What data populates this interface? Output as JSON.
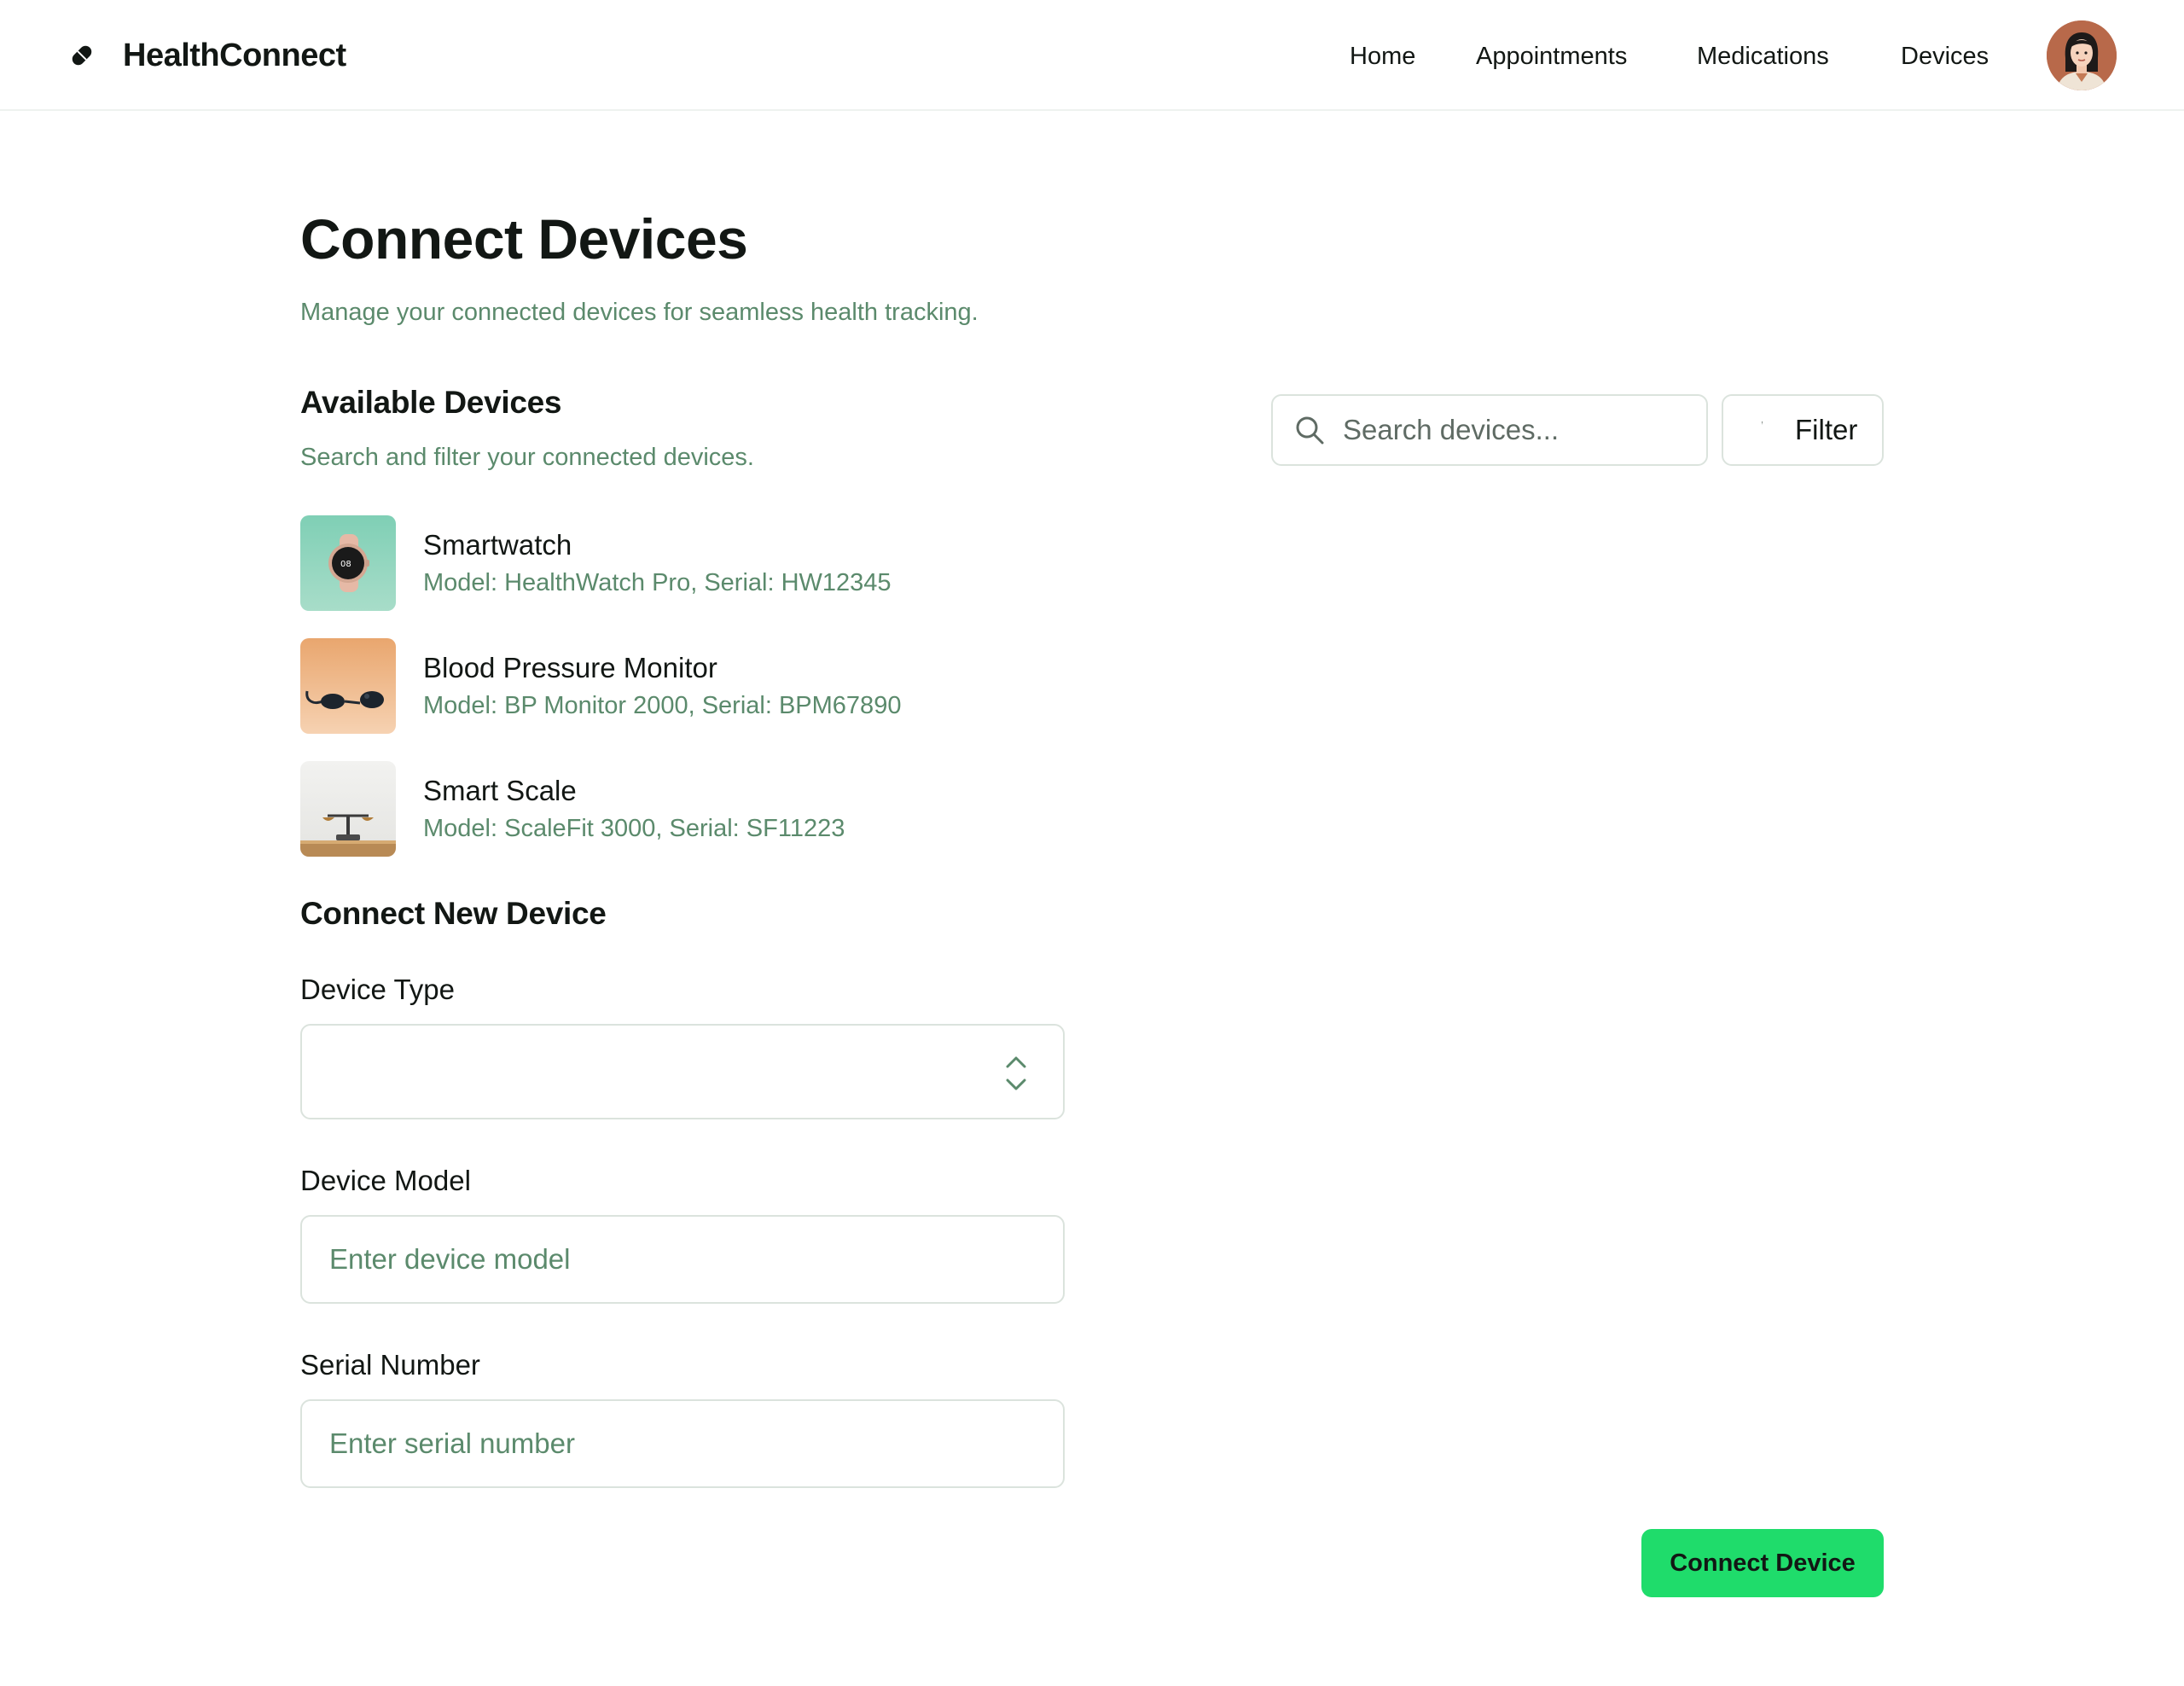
{
  "header": {
    "brand_name": "HealthConnect",
    "brand_icon": "pill-icon",
    "nav": [
      {
        "label": "Home"
      },
      {
        "label": "Appointments"
      },
      {
        "label": "Medications"
      },
      {
        "label": "Devices"
      }
    ],
    "avatar_icon": "user-avatar"
  },
  "main": {
    "title": "Connect Devices",
    "subtitle": "Manage your connected devices for seamless health tracking.",
    "available": {
      "title": "Available Devices",
      "subtitle": "Search and filter your connected devices.",
      "search_placeholder": "Search devices...",
      "search_icon": "search-icon",
      "filter_label": "Filter",
      "devices": [
        {
          "name": "Smartwatch",
          "meta": "Model: HealthWatch Pro, Serial: HW12345",
          "image": "smartwatch-image"
        },
        {
          "name": "Blood Pressure Monitor",
          "meta": "Model: BP Monitor 2000, Serial: BPM67890",
          "image": "blood-pressure-monitor-image"
        },
        {
          "name": "Smart Scale",
          "meta": "Model: ScaleFit 3000, Serial: SF11223",
          "image": "smart-scale-image"
        }
      ]
    },
    "connect_new": {
      "title": "Connect New Device",
      "device_type_label": "Device Type",
      "device_type_value": "",
      "device_model_label": "Device Model",
      "device_model_placeholder": "Enter device model",
      "serial_label": "Serial Number",
      "serial_placeholder": "Enter serial number",
      "submit_label": "Connect Device"
    }
  },
  "colors": {
    "accent": "#1fdc6b",
    "muted_text": "#5b8a6c",
    "border": "#dbe3dd",
    "text": "#121714"
  }
}
